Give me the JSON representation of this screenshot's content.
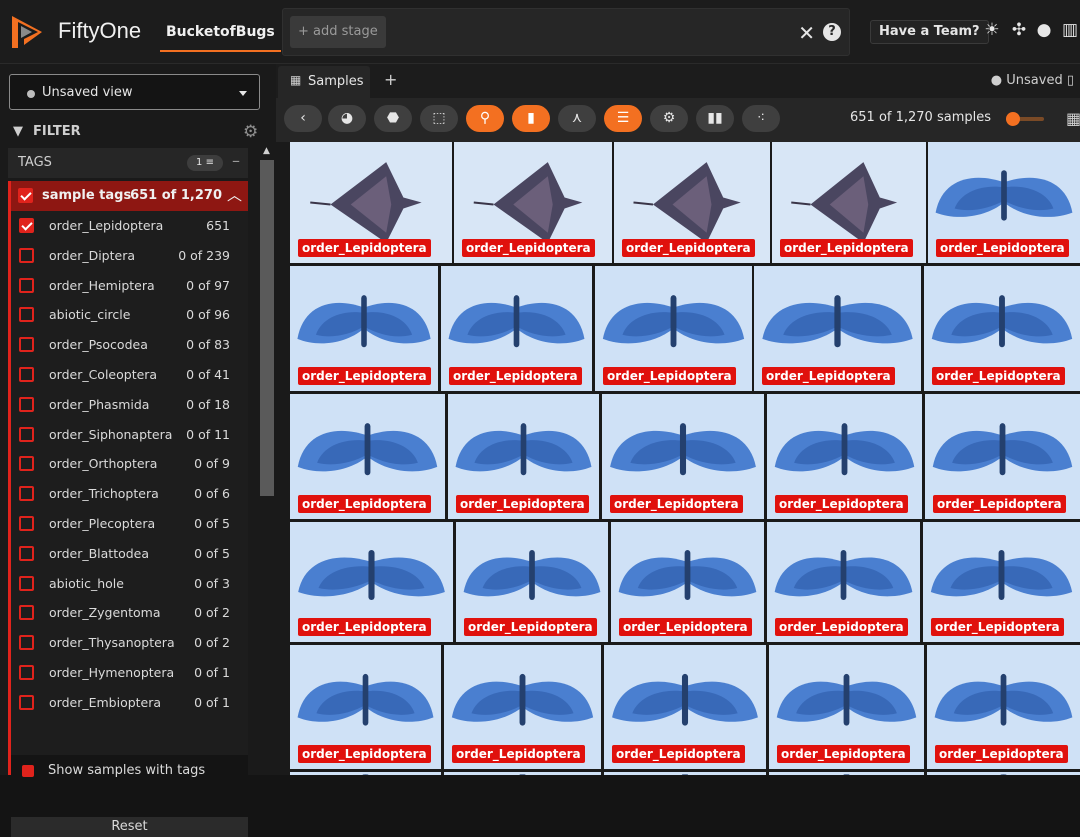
{
  "app": {
    "brand": "FiftyOne",
    "dataset": "BucketofBugs",
    "team_button": "Have a Team?",
    "header_icons": [
      "sun-icon",
      "slack-icon",
      "github-icon",
      "book-icon"
    ]
  },
  "stage_bar": {
    "add_stage": "+ add stage"
  },
  "sidebar": {
    "view_select": "Unsaved view",
    "filter_label": "FILTER",
    "tags_label": "TAGS",
    "tags_badge": "1",
    "group": {
      "label": "sample tags",
      "count": "651 of 1,270"
    },
    "tags": [
      {
        "name": "order_Lepidoptera",
        "count": "651",
        "checked": true
      },
      {
        "name": "order_Diptera",
        "count": "0 of 239",
        "checked": false
      },
      {
        "name": "order_Hemiptera",
        "count": "0 of 97",
        "checked": false
      },
      {
        "name": "abiotic_circle",
        "count": "0 of 96",
        "checked": false
      },
      {
        "name": "order_Psocodea",
        "count": "0 of 83",
        "checked": false
      },
      {
        "name": "order_Coleoptera",
        "count": "0 of 41",
        "checked": false
      },
      {
        "name": "order_Phasmida",
        "count": "0 of 18",
        "checked": false
      },
      {
        "name": "order_Siphonaptera",
        "count": "0 of 11",
        "checked": false
      },
      {
        "name": "order_Orthoptera",
        "count": "0 of 9",
        "checked": false
      },
      {
        "name": "order_Trichoptera",
        "count": "0 of 6",
        "checked": false
      },
      {
        "name": "order_Plecoptera",
        "count": "0 of 5",
        "checked": false
      },
      {
        "name": "order_Blattodea",
        "count": "0 of 5",
        "checked": false
      },
      {
        "name": "abiotic_hole",
        "count": "0 of 3",
        "checked": false
      },
      {
        "name": "order_Zygentoma",
        "count": "0 of 2",
        "checked": false
      },
      {
        "name": "order_Thysanoptera",
        "count": "0 of 2",
        "checked": false
      },
      {
        "name": "order_Hymenoptera",
        "count": "0 of 1",
        "checked": false
      },
      {
        "name": "order_Embioptera",
        "count": "0 of 1",
        "checked": false
      }
    ],
    "show_samples": "Show samples with tags",
    "reset": "Reset"
  },
  "main": {
    "tab_label": "Samples",
    "unsaved": "Unsaved",
    "sample_count": "651 of 1,270 samples",
    "tile_label": "order_Lepidoptera",
    "toolbar_icons": [
      "back-icon",
      "palette-icon",
      "tag-icon",
      "select-icon",
      "search-icon",
      "bookmark-icon",
      "merge-icon",
      "list-icon",
      "settings-icon",
      "chart-icon",
      "cluster-icon"
    ],
    "toolbar_active": [
      false,
      false,
      false,
      false,
      true,
      true,
      false,
      true,
      false,
      false,
      false
    ]
  },
  "colors": {
    "accent": "#f37021",
    "tag_red": "#e0231c",
    "label_red": "#e0110d"
  }
}
